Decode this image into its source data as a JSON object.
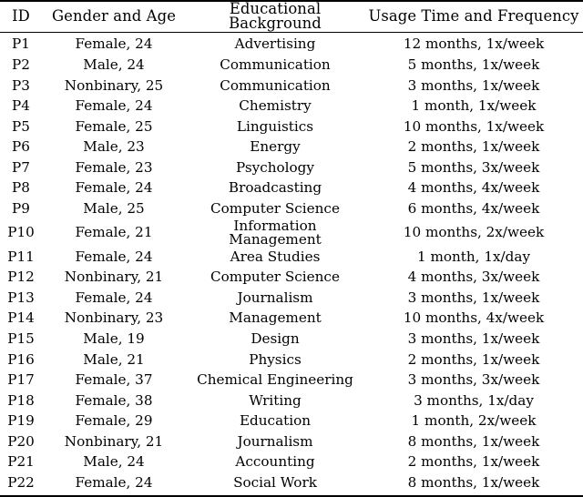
{
  "table": {
    "columns": [
      "ID",
      "Gender and Age",
      "Educational Background",
      "Usage Time and Frequency"
    ],
    "rows": [
      {
        "id": "P1",
        "gender_age": "Female, 24",
        "education": "Advertising",
        "usage": "12 months, 1x/week"
      },
      {
        "id": "P2",
        "gender_age": "Male, 24",
        "education": "Communication",
        "usage": "5 months, 1x/week"
      },
      {
        "id": "P3",
        "gender_age": "Nonbinary, 25",
        "education": "Communication",
        "usage": "3 months, 1x/week"
      },
      {
        "id": "P4",
        "gender_age": "Female, 24",
        "education": "Chemistry",
        "usage": "1 month, 1x/week"
      },
      {
        "id": "P5",
        "gender_age": "Female, 25",
        "education": "Linguistics",
        "usage": "10 months, 1x/week"
      },
      {
        "id": "P6",
        "gender_age": "Male, 23",
        "education": "Energy",
        "usage": "2 months, 1x/week"
      },
      {
        "id": "P7",
        "gender_age": "Female, 23",
        "education": "Psychology",
        "usage": "5 months, 3x/week"
      },
      {
        "id": "P8",
        "gender_age": "Female, 24",
        "education": "Broadcasting",
        "usage": "4 months, 4x/week"
      },
      {
        "id": "P9",
        "gender_age": "Male, 25",
        "education": "Computer Science",
        "usage": "6 months, 4x/week"
      },
      {
        "id": "P10",
        "gender_age": "Female, 21",
        "education": "Information Management",
        "usage": "10 months, 2x/week"
      },
      {
        "id": "P11",
        "gender_age": "Female, 24",
        "education": "Area Studies",
        "usage": "1 month, 1x/day"
      },
      {
        "id": "P12",
        "gender_age": "Nonbinary, 21",
        "education": "Computer Science",
        "usage": "4 months, 3x/week"
      },
      {
        "id": "P13",
        "gender_age": "Female, 24",
        "education": "Journalism",
        "usage": "3 months, 1x/week"
      },
      {
        "id": "P14",
        "gender_age": "Nonbinary, 23",
        "education": "Management",
        "usage": "10 months, 4x/week"
      },
      {
        "id": "P15",
        "gender_age": "Male, 19",
        "education": "Design",
        "usage": "3 months, 1x/week"
      },
      {
        "id": "P16",
        "gender_age": "Male, 21",
        "education": "Physics",
        "usage": "2 months, 1x/week"
      },
      {
        "id": "P17",
        "gender_age": "Female, 37",
        "education": "Chemical Engineering",
        "usage": "3 months, 3x/week"
      },
      {
        "id": "P18",
        "gender_age": "Female, 38",
        "education": "Writing",
        "usage": "3 months, 1x/day"
      },
      {
        "id": "P19",
        "gender_age": "Female, 29",
        "education": "Education",
        "usage": "1 month, 2x/week"
      },
      {
        "id": "P20",
        "gender_age": "Nonbinary, 21",
        "education": "Journalism",
        "usage": "8 months, 1x/week"
      },
      {
        "id": "P21",
        "gender_age": "Male, 24",
        "education": "Accounting",
        "usage": "2 months, 1x/week"
      },
      {
        "id": "P22",
        "gender_age": "Female, 24",
        "education": "Social Work",
        "usage": "8 months, 1x/week"
      }
    ]
  }
}
